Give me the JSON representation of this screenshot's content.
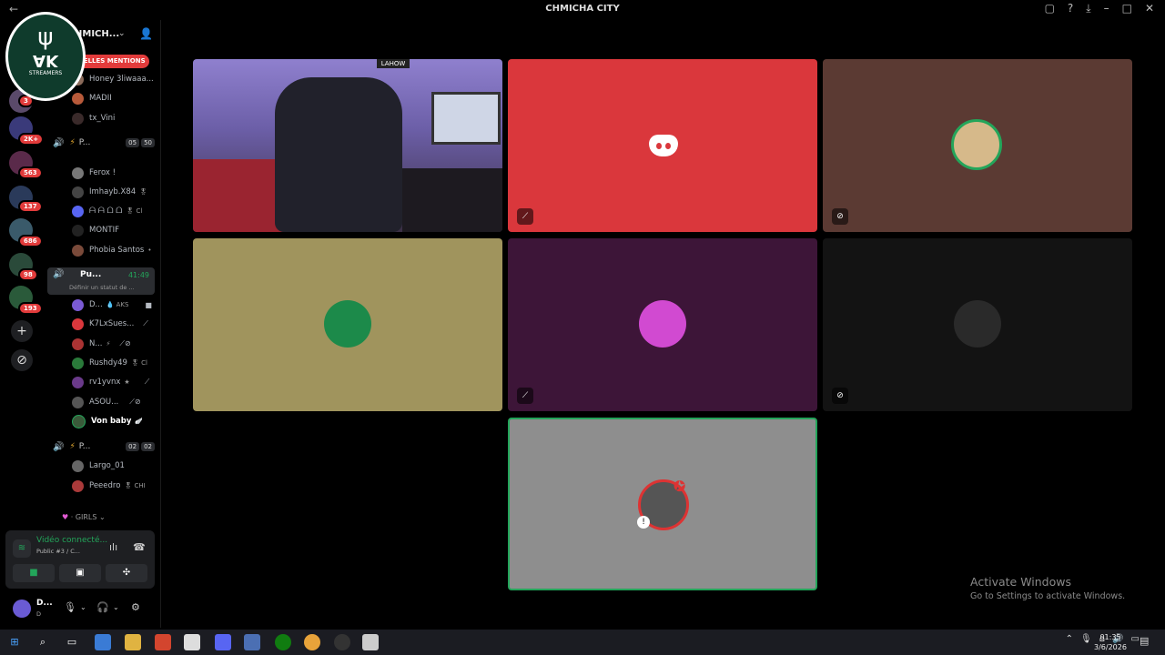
{
  "window": {
    "title": "CHMICHA CITY",
    "back": "←"
  },
  "servers": {
    "badges": [
      "3",
      "2K+",
      "563",
      "137",
      "686",
      "98",
      "193"
    ],
    "add_label": "+",
    "explore_label": "⊘"
  },
  "logo": {
    "mark": "ψ",
    "letters": "AK",
    "sub": "STREAMERS"
  },
  "sidebar": {
    "guild_name": "HMICH...",
    "mentions_label": "VELLES MENTIONS",
    "top_users": [
      {
        "name": "Honey 3liwaaa...",
        "color": "#8a6a5a"
      },
      {
        "name": "MADII",
        "color": "#b85a3a"
      },
      {
        "name": "tx_Vini",
        "color": "#3a2a2a"
      }
    ],
    "vc1": {
      "name": "P...",
      "count_a": "05",
      "count_b": "50",
      "users": [
        {
          "name": "Ferox !",
          "extra": "",
          "color": "#777"
        },
        {
          "name": "Imhayb.X84",
          "extra": "🎖",
          "color": "#444"
        },
        {
          "name": "ᗩ ᗩ ᗝ ᗝ",
          "extra": "🎖 Cl",
          "color": "#5865f2"
        },
        {
          "name": "MONTIF",
          "extra": "",
          "color": "#222"
        },
        {
          "name": "Phobia Santos",
          "extra": "•",
          "color": "#7a4a3a"
        }
      ]
    },
    "vc_active": {
      "name": "Pu...",
      "time": "41:49",
      "status": "Définir un statut de ..."
    },
    "vc2_users": [
      {
        "name": "D...",
        "extra": "💧 AKS",
        "color": "#7a5ad4",
        "bold": false
      },
      {
        "name": "K7LxSues...",
        "extra": "",
        "color": "#da373c",
        "bold": false
      },
      {
        "name": "N...",
        "extra": "⚡",
        "color": "#a33",
        "bold": false
      },
      {
        "name": "Rushdy49",
        "extra": "🎖 Cl",
        "color": "#2a7a3a",
        "bold": false
      },
      {
        "name": "rv1yvnx",
        "extra": "★",
        "color": "#6a3a8a",
        "bold": false
      },
      {
        "name": "ASOU...",
        "extra": "",
        "color": "#555",
        "bold": false
      },
      {
        "name": "Von baby",
        "extra": "🪽",
        "color": "#3a5a3a",
        "bold": true
      }
    ],
    "vc3": {
      "name": "P...",
      "count_a": "02",
      "count_b": "02",
      "users": [
        {
          "name": "Largo_01",
          "extra": "",
          "color": "#666"
        },
        {
          "name": "Peeedro",
          "extra": "🎖 CHI",
          "color": "#aa3a3a"
        }
      ]
    },
    "girls_label": "GIRLS"
  },
  "voice_panel": {
    "title": "Vidéo connecté...",
    "sub": "Public #3 / C...",
    "btn_camera": "■",
    "btn_screen": "▣",
    "btn_activity": "✣"
  },
  "me": {
    "name": "D...",
    "status": "D"
  },
  "tiles": {
    "discord_mute": "⟋",
    "brown_mute": "⊘",
    "purple_mute": "⟋",
    "dark_mute": "⊘",
    "sign": "LAHOW"
  },
  "watermark": {
    "line1": "Activate Windows",
    "line2": "Go to Settings to activate Windows."
  },
  "taskbar": {
    "time": "01:35",
    "date": "3/6/2026"
  },
  "colors": {
    "accent_green": "#23a55a",
    "discord_red": "#da373c",
    "mention_red": "#e23b3b"
  }
}
